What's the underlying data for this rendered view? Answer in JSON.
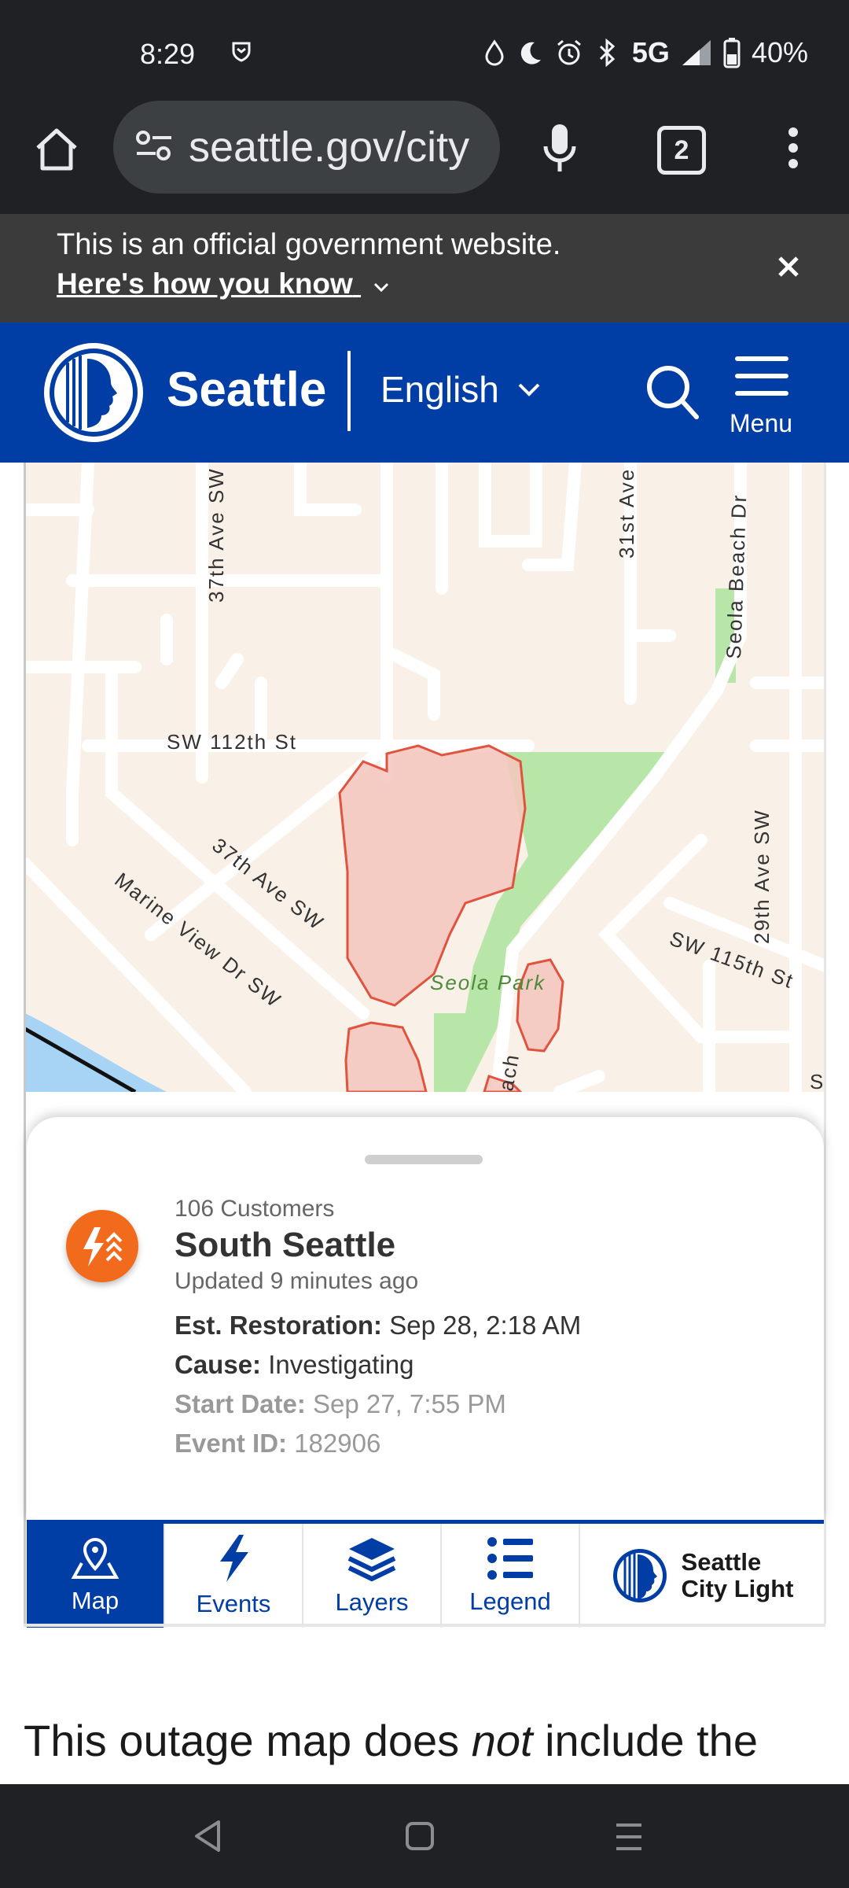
{
  "status_bar": {
    "time": "8:29",
    "network": "5G",
    "battery": "40%"
  },
  "browser": {
    "url": "seattle.gov/city",
    "tab_count": "2"
  },
  "gov_banner": {
    "text": "This is an official government website.",
    "link": "Here's how you know"
  },
  "header": {
    "site_name": "Seattle",
    "language": "English",
    "menu_label": "Menu"
  },
  "map": {
    "street_labels": {
      "ave37_top": "37th Ave SW",
      "ave31": "31st Ave",
      "seola_beach": "Seola Beach Dr",
      "sw112": "SW 112th St",
      "ave37_diag": "37th Ave SW",
      "marine_view": "Marine View Dr SW",
      "seola_park": "Seola Park",
      "sw115": "SW 115th St",
      "ave29": "29th Ave SW",
      "beach_partial": "ach",
      "edge_s": "S"
    }
  },
  "outage": {
    "customers": "106 Customers",
    "area": "South Seattle",
    "updated": "Updated 9 minutes ago",
    "restoration_label": "Est. Restoration:",
    "restoration_value": "Sep 28, 2:18 AM",
    "cause_label": "Cause:",
    "cause_value": "Investigating",
    "start_label": "Start Date:",
    "start_value": "Sep 27, 7:55 PM",
    "event_label": "Event ID:",
    "event_value": "182906"
  },
  "tabs": [
    {
      "label": "Map"
    },
    {
      "label": "Events"
    },
    {
      "label": "Layers"
    },
    {
      "label": "Legend"
    }
  ],
  "brand": {
    "line1": "Seattle",
    "line2": "City Light"
  },
  "paragraph": {
    "before": "This outage map does ",
    "emphasis": "not",
    "after": " include the"
  },
  "colors": {
    "brand_blue": "#003da5",
    "outage_orange": "#f26b1d",
    "outage_area_fill": "#f4c6bd",
    "outage_area_stroke": "#e0533f",
    "park_green": "#b8e6a8",
    "water_blue": "#a7d3f5"
  }
}
